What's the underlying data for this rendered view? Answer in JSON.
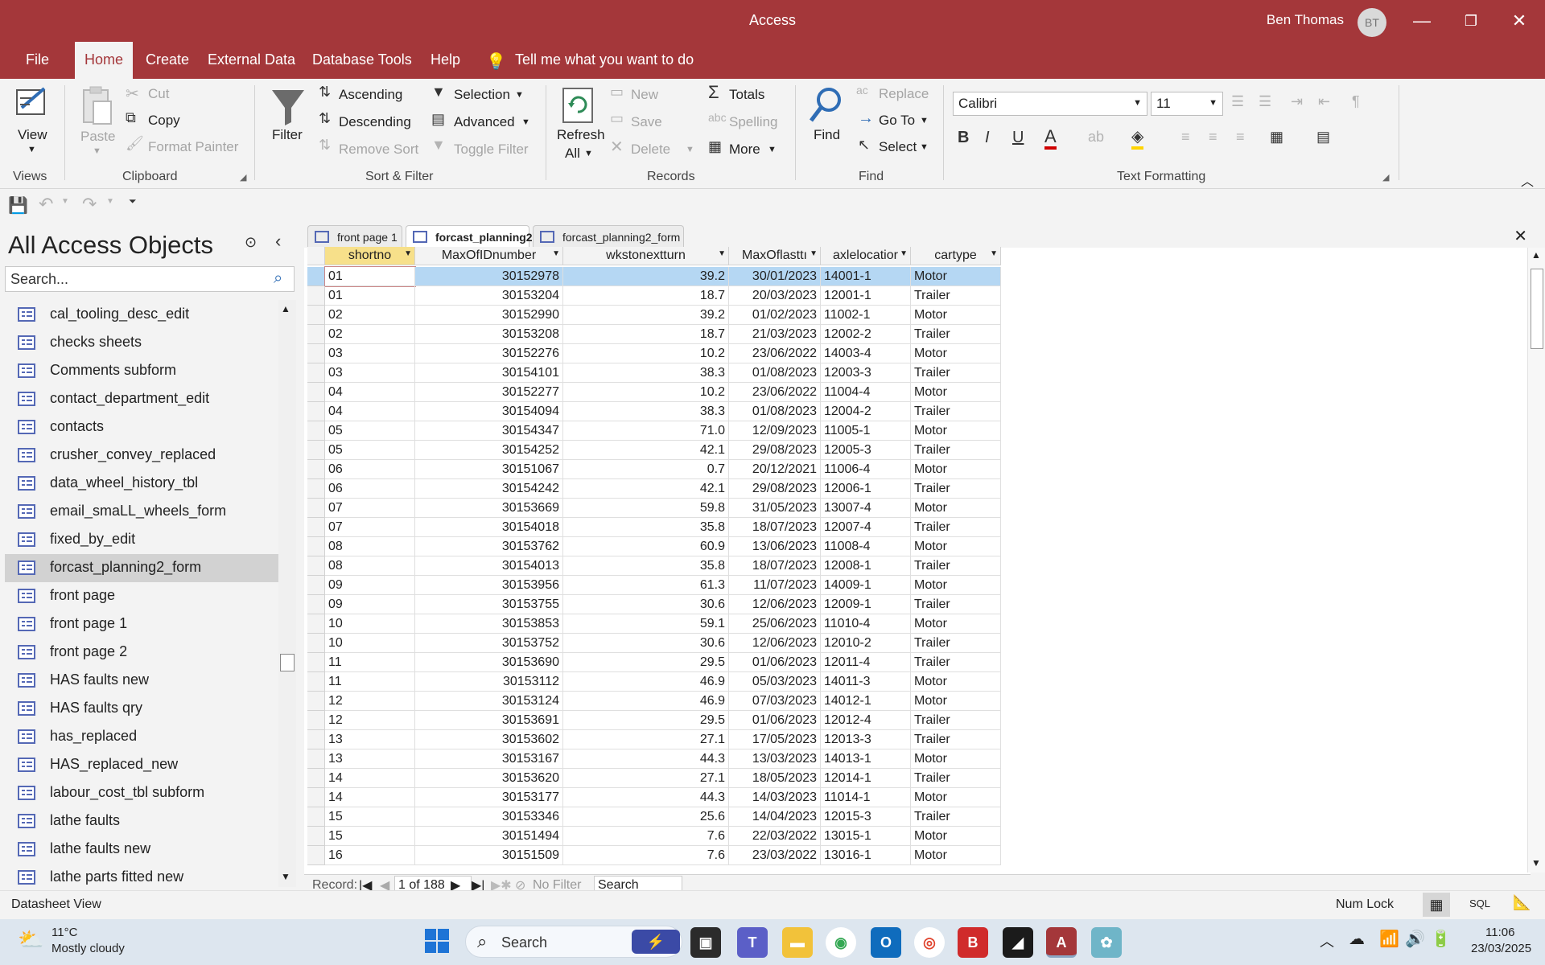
{
  "app": {
    "title": "Access",
    "user": "Ben Thomas",
    "initials": "BT"
  },
  "menu": {
    "tabs": [
      "File",
      "Home",
      "Create",
      "External Data",
      "Database Tools",
      "Help"
    ],
    "active": "Home",
    "tell_me": "Tell me what you want to do"
  },
  "ribbon": {
    "views": {
      "view": "View",
      "group": "Views"
    },
    "clipboard": {
      "paste": "Paste",
      "cut": "Cut",
      "copy": "Copy",
      "format_painter": "Format Painter",
      "group": "Clipboard"
    },
    "sort_filter": {
      "filter": "Filter",
      "ascending": "Ascending",
      "descending": "Descending",
      "remove_sort": "Remove Sort",
      "selection": "Selection",
      "advanced": "Advanced",
      "toggle_filter": "Toggle Filter",
      "group": "Sort & Filter"
    },
    "records": {
      "refresh": "Refresh",
      "all": "All",
      "new": "New",
      "save": "Save",
      "delete": "Delete",
      "totals": "Totals",
      "spelling": "Spelling",
      "more": "More",
      "group": "Records"
    },
    "find": {
      "find": "Find",
      "replace": "Replace",
      "go_to": "Go To",
      "select": "Select",
      "group": "Find"
    },
    "text_formatting": {
      "font": "Calibri",
      "size": "11",
      "group": "Text Formatting"
    }
  },
  "nav": {
    "title": "All Access Objects",
    "search_placeholder": "Search...",
    "items": [
      "cal_tooling_desc_edit",
      "checks sheets",
      "Comments subform",
      "contact_department_edit",
      "contacts",
      "crusher_convey_replaced",
      "data_wheel_history_tbl",
      "email_smaLL_wheels_form",
      "fixed_by_edit",
      "forcast_planning2_form",
      "front page",
      "front page 1",
      "front page 2",
      "HAS faults new",
      "HAS faults qry",
      "has_replaced",
      "HAS_replaced_new",
      "labour_cost_tbl subform",
      "lathe faults",
      "lathe faults new",
      "lathe parts fitted new"
    ],
    "selected": "forcast_planning2_form"
  },
  "doc_tabs": [
    {
      "label": "front page 1",
      "active": false
    },
    {
      "label": "forcast_planning2",
      "active": true
    },
    {
      "label": "forcast_planning2_form",
      "active": false
    }
  ],
  "grid": {
    "columns": [
      "shortno",
      "MaxOfIDnumber",
      "wkstonextturn",
      "MaxOflasttı",
      "axlelocatior",
      "cartype"
    ],
    "rows": [
      [
        "01",
        "30152978",
        "39.2",
        "30/01/2023",
        "14001-1",
        "Motor"
      ],
      [
        "01",
        "30153204",
        "18.7",
        "20/03/2023",
        "12001-1",
        "Trailer"
      ],
      [
        "02",
        "30152990",
        "39.2",
        "01/02/2023",
        "11002-1",
        "Motor"
      ],
      [
        "02",
        "30153208",
        "18.7",
        "21/03/2023",
        "12002-2",
        "Trailer"
      ],
      [
        "03",
        "30152276",
        "10.2",
        "23/06/2022",
        "14003-4",
        "Motor"
      ],
      [
        "03",
        "30154101",
        "38.3",
        "01/08/2023",
        "12003-3",
        "Trailer"
      ],
      [
        "04",
        "30152277",
        "10.2",
        "23/06/2022",
        "11004-4",
        "Motor"
      ],
      [
        "04",
        "30154094",
        "38.3",
        "01/08/2023",
        "12004-2",
        "Trailer"
      ],
      [
        "05",
        "30154347",
        "71.0",
        "12/09/2023",
        "11005-1",
        "Motor"
      ],
      [
        "05",
        "30154252",
        "42.1",
        "29/08/2023",
        "12005-3",
        "Trailer"
      ],
      [
        "06",
        "30151067",
        "0.7",
        "20/12/2021",
        "11006-4",
        "Motor"
      ],
      [
        "06",
        "30154242",
        "42.1",
        "29/08/2023",
        "12006-1",
        "Trailer"
      ],
      [
        "07",
        "30153669",
        "59.8",
        "31/05/2023",
        "13007-4",
        "Motor"
      ],
      [
        "07",
        "30154018",
        "35.8",
        "18/07/2023",
        "12007-4",
        "Trailer"
      ],
      [
        "08",
        "30153762",
        "60.9",
        "13/06/2023",
        "11008-4",
        "Motor"
      ],
      [
        "08",
        "30154013",
        "35.8",
        "18/07/2023",
        "12008-1",
        "Trailer"
      ],
      [
        "09",
        "30153956",
        "61.3",
        "11/07/2023",
        "14009-1",
        "Motor"
      ],
      [
        "09",
        "30153755",
        "30.6",
        "12/06/2023",
        "12009-1",
        "Trailer"
      ],
      [
        "10",
        "30153853",
        "59.1",
        "25/06/2023",
        "11010-4",
        "Motor"
      ],
      [
        "10",
        "30153752",
        "30.6",
        "12/06/2023",
        "12010-2",
        "Trailer"
      ],
      [
        "11",
        "30153690",
        "29.5",
        "01/06/2023",
        "12011-4",
        "Trailer"
      ],
      [
        "11",
        "30153112",
        "46.9",
        "05/03/2023",
        "14011-3",
        "Motor"
      ],
      [
        "12",
        "30153124",
        "46.9",
        "07/03/2023",
        "14012-1",
        "Motor"
      ],
      [
        "12",
        "30153691",
        "29.5",
        "01/06/2023",
        "12012-4",
        "Trailer"
      ],
      [
        "13",
        "30153602",
        "27.1",
        "17/05/2023",
        "12013-3",
        "Trailer"
      ],
      [
        "13",
        "30153167",
        "44.3",
        "13/03/2023",
        "14013-1",
        "Motor"
      ],
      [
        "14",
        "30153620",
        "27.1",
        "18/05/2023",
        "12014-1",
        "Trailer"
      ],
      [
        "14",
        "30153177",
        "44.3",
        "14/03/2023",
        "11014-1",
        "Motor"
      ],
      [
        "15",
        "30153346",
        "25.6",
        "14/04/2023",
        "12015-3",
        "Trailer"
      ],
      [
        "15",
        "30151494",
        "7.6",
        "22/03/2022",
        "13015-1",
        "Motor"
      ],
      [
        "16",
        "30151509",
        "7.6",
        "23/03/2022",
        "13016-1",
        "Motor"
      ]
    ]
  },
  "record_nav": {
    "label": "Record:",
    "position": "1 of 188",
    "filter": "No Filter",
    "search": "Search"
  },
  "status": {
    "left": "Datasheet View",
    "num_lock": "Num Lock",
    "sql": "SQL"
  },
  "taskbar": {
    "temp": "11°C",
    "weather": "Mostly cloudy",
    "search": "Search",
    "time": "11:06",
    "date": "23/03/2025"
  }
}
